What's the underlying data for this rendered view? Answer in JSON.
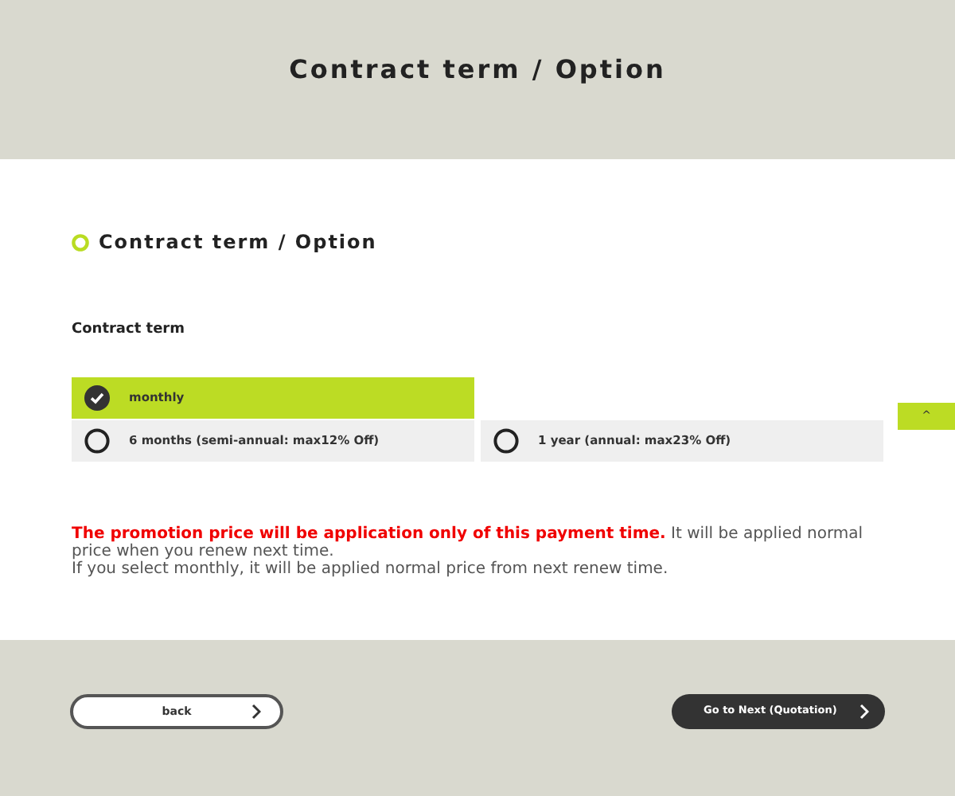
{
  "header": {
    "title": "Contract term / Option"
  },
  "section": {
    "title": "Contract term / Option"
  },
  "field_label": "Contract term",
  "options": [
    {
      "label": "monthly",
      "selected": true
    },
    {
      "label": "6 months (semi-annual: max12% Off)",
      "selected": false
    },
    {
      "label": "1 year (annual: max23% Off)",
      "selected": false
    }
  ],
  "scroll_top": "^",
  "notice": {
    "highlight": "The promotion price will be application only of this payment time.",
    "text": " It will be applied normal price when you renew next time.",
    "line2": "If you select monthly, it will be applied normal price from next renew time."
  },
  "buttons": {
    "back": "back",
    "next": "Go to Next (Quotation)"
  }
}
